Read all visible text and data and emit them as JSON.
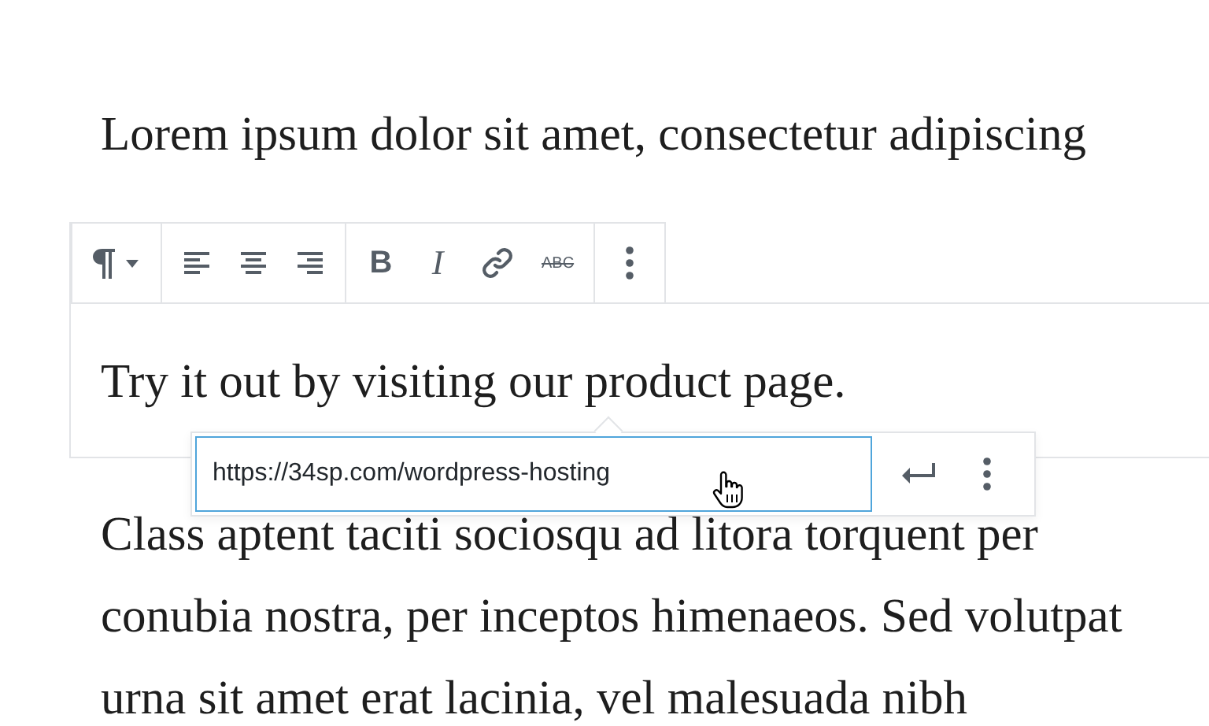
{
  "paragraph_before": {
    "text": "Lorem ipsum dolor sit amet, consectetur adipiscing"
  },
  "selected_block": {
    "text": "Try it out by visiting our product page.",
    "toolbar": {
      "groups": [
        [
          {
            "kind": "paragraph"
          }
        ],
        [
          {
            "kind": "align-left"
          },
          {
            "kind": "align-center"
          },
          {
            "kind": "align-right"
          }
        ],
        [
          {
            "kind": "bold",
            "label": "B"
          },
          {
            "kind": "italic",
            "label": "I"
          },
          {
            "kind": "link"
          },
          {
            "kind": "strikethrough",
            "label": "ABC"
          }
        ],
        [
          {
            "kind": "more"
          }
        ]
      ]
    },
    "link_popover": {
      "url": "https://34sp.com/wordpress-hosting",
      "buttons": [
        {
          "kind": "submit"
        },
        {
          "kind": "more"
        }
      ]
    }
  },
  "paragraph_after": {
    "text": "Class aptent taciti sociosqu ad litora torquent per conubia nostra, per inceptos himenaeos. Sed volutpat urna sit amet erat lacinia, vel malesuada nibh"
  }
}
